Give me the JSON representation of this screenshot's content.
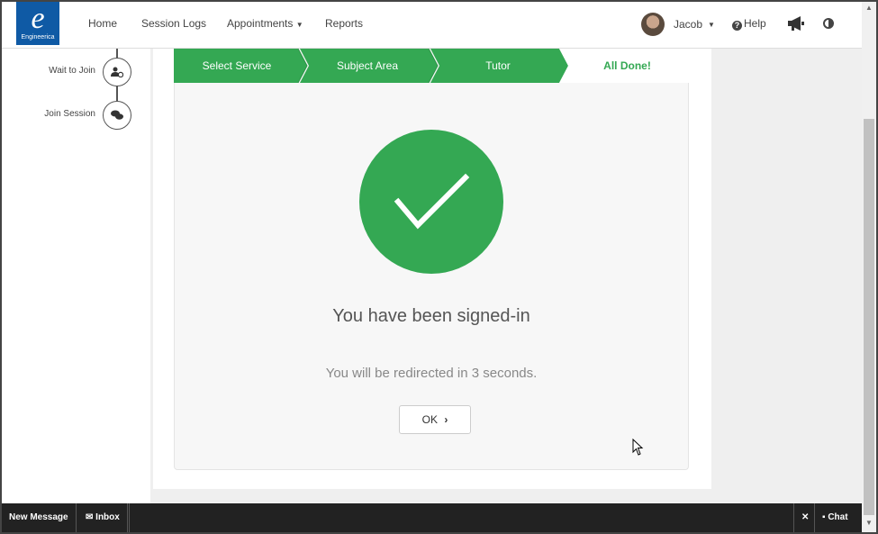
{
  "header": {
    "logo_letter": "e",
    "logo_text": "Engineerica",
    "nav": {
      "home": "Home",
      "session_logs": "Session Logs",
      "appointments": "Appointments",
      "reports": "Reports"
    },
    "user_name": "Jacob",
    "help": "Help"
  },
  "sidebar": {
    "steps": [
      {
        "label": "Wait to Join",
        "icon": "user-clock-icon"
      },
      {
        "label": "Join Session",
        "icon": "comments-icon"
      }
    ]
  },
  "wizard": {
    "steps": [
      "Select Service",
      "Subject Area",
      "Tutor",
      "All Done!"
    ],
    "active_color": "#34a853"
  },
  "main": {
    "headline": "You have been signed-in",
    "redirect_text": "You will be redirected in 3 seconds.",
    "ok_label": "OK"
  },
  "bottom_bar": {
    "new_message": "New Message",
    "inbox": "Inbox",
    "chat": "Chat"
  }
}
